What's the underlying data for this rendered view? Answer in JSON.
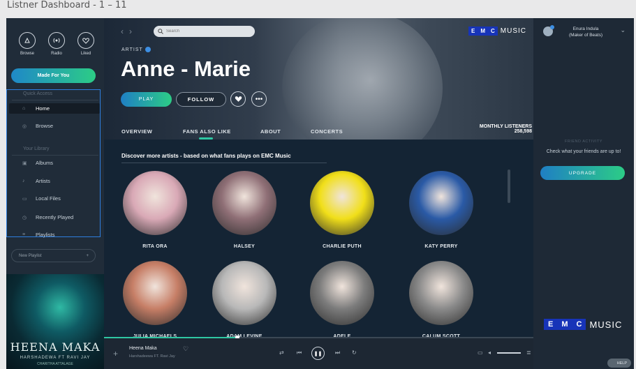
{
  "doc_title": "Listner Dashboard - 1 – 11",
  "sidebar": {
    "top_icons": [
      {
        "label": "Browse",
        "icon": "browse-icon"
      },
      {
        "label": "Radio",
        "icon": "radio-icon"
      },
      {
        "label": "Liked",
        "icon": "heart-icon"
      }
    ],
    "made_for_you": "Made For You",
    "quick_access_head": "Quick Access",
    "quick_items": [
      {
        "label": "Home",
        "icon": "home-icon"
      },
      {
        "label": "Browse",
        "icon": "browse-icon"
      }
    ],
    "library_head": "Your Library",
    "library_items": [
      {
        "label": "Albums",
        "icon": "albums-icon"
      },
      {
        "label": "Artists",
        "icon": "artists-icon"
      },
      {
        "label": "Local Files",
        "icon": "local-files-icon"
      },
      {
        "label": "Recently Played",
        "icon": "recent-icon"
      },
      {
        "label": "Playlists",
        "icon": "playlists-icon"
      }
    ],
    "new_playlist_placeholder": "New Playlist",
    "album": {
      "title": "HEENA MAKA",
      "artists": "HARSHADEWA FT RAVI JAY",
      "credit": "CHARITHA ATTALAGE"
    }
  },
  "header": {
    "search_placeholder": "Search",
    "logo_letters": [
      "E",
      "M",
      "C"
    ],
    "logo_word": "MUSIC"
  },
  "artist": {
    "label": "ARTIST",
    "name": "Anne - Marie",
    "play_label": "PLAY",
    "follow_label": "FOLLOW",
    "tabs": [
      "OVERVIEW",
      "FANS ALSO LIKE",
      "ABOUT",
      "CONCERTS"
    ],
    "listeners_label": "MONTHLY LISTENERS",
    "listeners_value": "258,598"
  },
  "discover": {
    "title": "Discover more artists - based on what fans plays on EMC Music",
    "artists": [
      {
        "name": "RITA ORA",
        "color": "#d9a9b6"
      },
      {
        "name": "HALSEY",
        "color": "#8f6f76"
      },
      {
        "name": "CHARLIE PUTH",
        "color": "#f1df19"
      },
      {
        "name": "KATY PERRY",
        "color": "#2a5aa6"
      },
      {
        "name": "JULIA MICHAELS",
        "color": "#c67e66"
      },
      {
        "name": "ADAM LEVINE",
        "color": "#b8b8b8"
      },
      {
        "name": "ADELE",
        "color": "#7c7c7c"
      },
      {
        "name": "CALUM SCOTT",
        "color": "#8a8a8a"
      }
    ]
  },
  "player": {
    "track_title": "Heena Maka",
    "track_artist": "Harshadeewa FT. Ravi Jay",
    "progress": 0.31
  },
  "right_panel": {
    "user_name": "Enura Indula",
    "user_role": "(Maker of Beats)",
    "friend_activity_title": "FRIEND ACTIVITY",
    "friend_activity_text": "Check what your friends are up to!",
    "upgrade_label": "UPGRADE",
    "help_label": "HELP"
  },
  "colors": {
    "accent_green": "#2ccc86",
    "accent_blue": "#1f7fc4",
    "emc_blue": "#1734b8"
  }
}
